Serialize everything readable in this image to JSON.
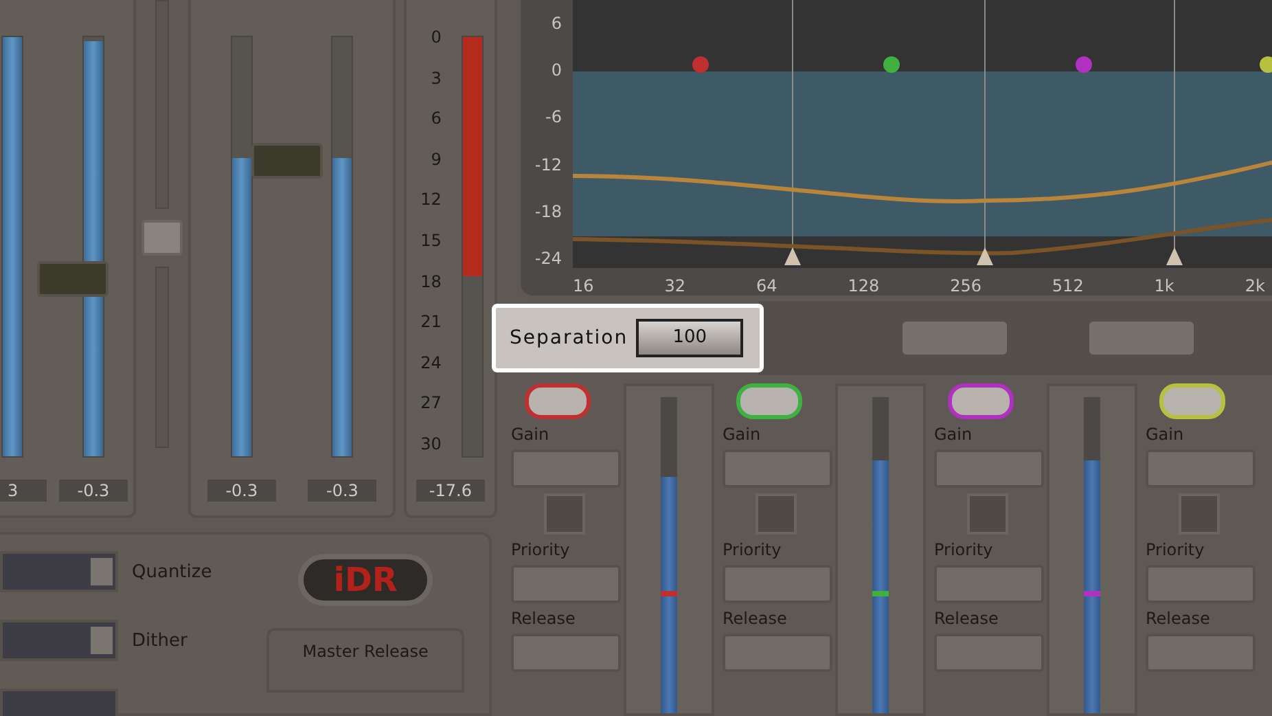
{
  "meter_groups": [
    {
      "meters": [
        {
          "level": 1.0,
          "reading": "3"
        },
        {
          "level": 0.99,
          "reading": "-0.3"
        }
      ]
    },
    {
      "meters": [
        {
          "level": 0.71,
          "reading": "-0.3"
        },
        {
          "level": 0.71,
          "reading": "-0.3"
        }
      ]
    }
  ],
  "reduction_meter": {
    "scale": [
      "0",
      "3",
      "6",
      "9",
      "12",
      "15",
      "18",
      "21",
      "24",
      "27",
      "30"
    ],
    "level": 0.57,
    "reading": "-17.6"
  },
  "options": [
    {
      "label": "Quantize"
    },
    {
      "label": "Dither"
    }
  ],
  "logo": "iDR",
  "master_release": {
    "label": "Master Release"
  },
  "eq_display": {
    "y_ticks": [
      "6",
      "0",
      "-6",
      "-12",
      "-18",
      "-24"
    ],
    "x_ticks": [
      "16",
      "32",
      "64",
      "128",
      "256",
      "512",
      "1k",
      "2k"
    ]
  },
  "separation": {
    "label": "Separation",
    "value": "100"
  },
  "bands": [
    {
      "color": "#c03030",
      "on": true,
      "gain_label": "Gain",
      "priority_label": "Priority",
      "release_label": "Release",
      "level": 0.75,
      "marker": {
        "level": 0.37
      }
    },
    {
      "color": "#40b040",
      "on": true,
      "gain_label": "Gain",
      "priority_label": "Priority",
      "release_label": "Release",
      "level": 0.8,
      "marker": {
        "level": 0.37
      }
    },
    {
      "color": "#b030c0",
      "on": true,
      "gain_label": "Gain",
      "priority_label": "Priority",
      "release_label": "Release",
      "level": 0.8,
      "marker": {
        "level": 0.37
      }
    },
    {
      "color": "#b8c040",
      "on": true,
      "gain_label": "Gain",
      "priority_label": "Priority",
      "release_label": "Release"
    }
  ]
}
